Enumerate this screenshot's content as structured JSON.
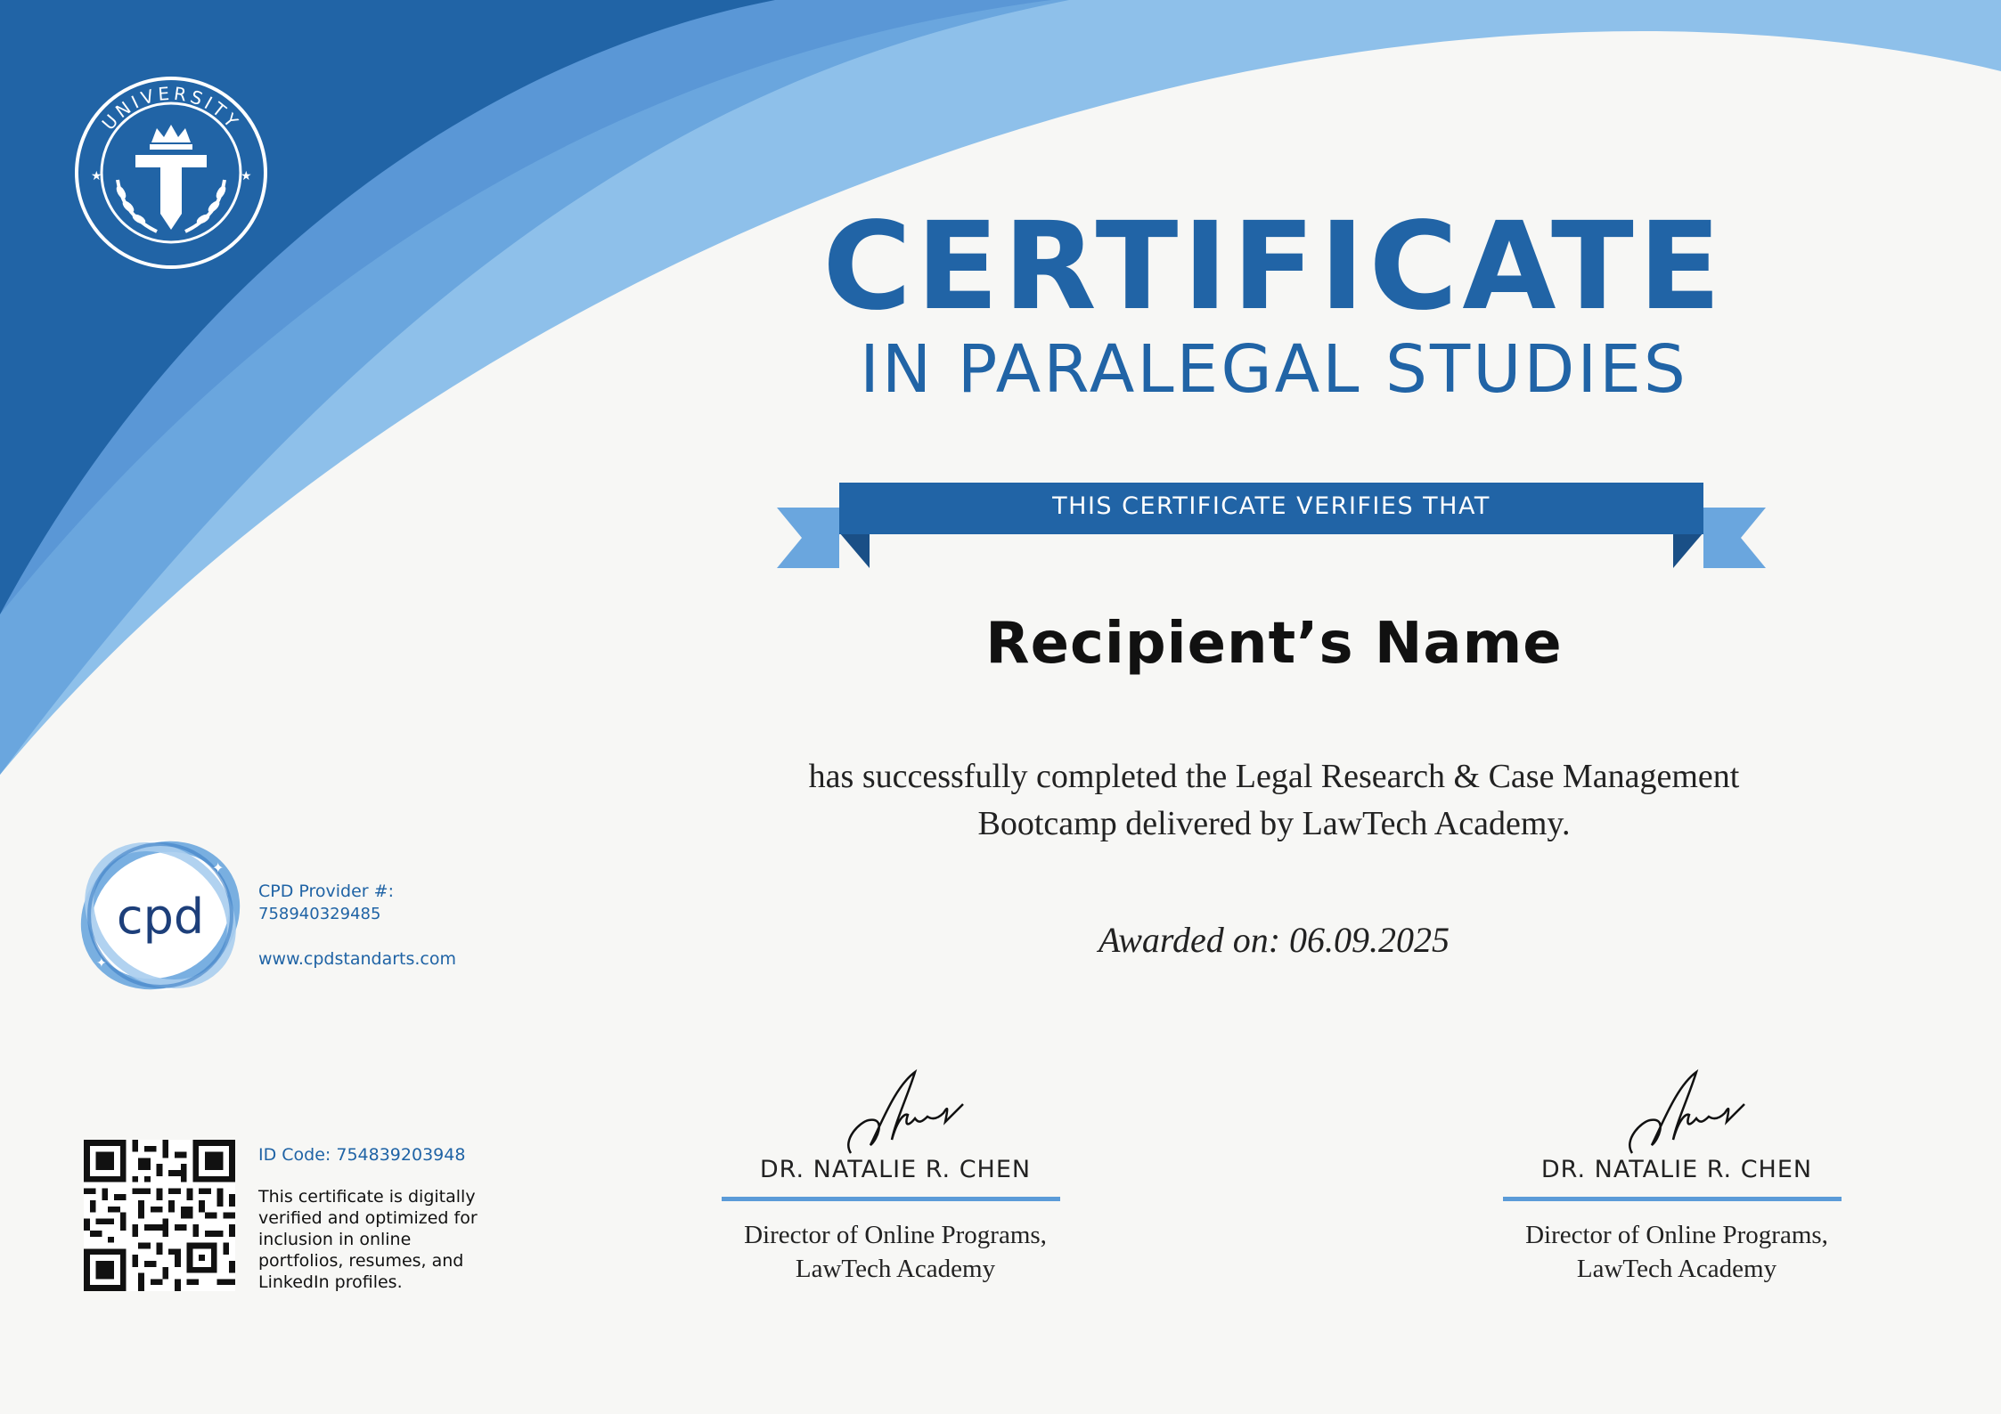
{
  "colors": {
    "primary_blue": "#2164a6",
    "light_blue": "#6aa6de",
    "pale_blue": "#8ec0ea",
    "background": "#f7f7f5"
  },
  "logo": {
    "text": "UNIVERSITY",
    "icon": "university-crest-icon"
  },
  "title": {
    "main": "CERTIFICATE",
    "sub": "IN PARALEGAL STUDIES"
  },
  "ribbon": {
    "text": "THIS CERTIFICATE VERIFIES THAT"
  },
  "recipient": {
    "name": "Recipient’s Name"
  },
  "body": {
    "line1": "has successfully completed the Legal Research & Case Management",
    "line2": "Bootcamp delivered by LawTech Academy."
  },
  "awarded": {
    "text": "Awarded on: 06.09.2025"
  },
  "signatures": [
    {
      "name": "DR. NATALIE R. CHEN",
      "title_line1": "Director of Online Programs,",
      "title_line2": "LawTech Academy"
    },
    {
      "name": "DR. NATALIE R. CHEN",
      "title_line1": "Director of Online Programs,",
      "title_line2": "LawTech Academy"
    }
  ],
  "cpd": {
    "badge_text": "cpd",
    "provider_label": "CPD Provider #:",
    "provider_number": "758940329485",
    "url": "www.cpdstandarts.com"
  },
  "verification": {
    "id_code": "ID Code: 754839203948",
    "line1": "This certificate is digitally",
    "line2": "verified and optimized for",
    "line3": "inclusion in online",
    "line4": "portfolios, resumes, and",
    "line5": "LinkedIn profiles."
  }
}
